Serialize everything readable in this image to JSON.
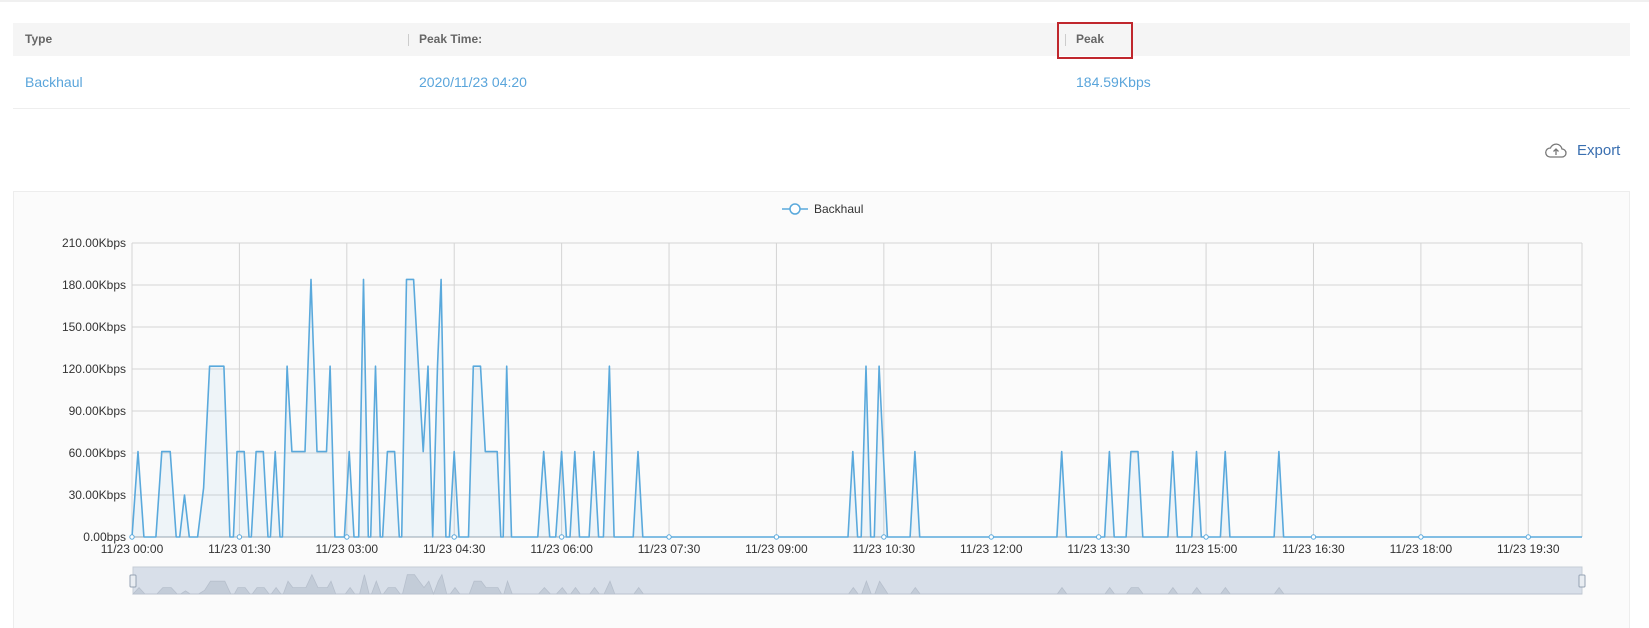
{
  "table": {
    "headers": {
      "type": "Type",
      "peak_time": "Peak Time:",
      "peak": "Peak"
    },
    "row": {
      "type": "Backhaul",
      "peak_time": "2020/11/23 04:20",
      "peak": "184.59Kbps"
    }
  },
  "export": {
    "label": "Export",
    "icon": "cloud-export-icon"
  },
  "colors": {
    "series": "#5aa9dc",
    "link": "#5aa5db",
    "highlight": "#c0272d",
    "slider": "#d8dfe9"
  },
  "chart_data": {
    "type": "line",
    "legend": "Backhaul",
    "legend_position": "top-center",
    "grid": true,
    "y_ticks": [
      "0.00bps",
      "30.00Kbps",
      "60.00Kbps",
      "90.00Kbps",
      "120.00Kbps",
      "150.00Kbps",
      "180.00Kbps",
      "210.00Kbps"
    ],
    "x_ticks": [
      "11/23 00:00",
      "11/23 01:30",
      "11/23 03:00",
      "11/23 04:30",
      "11/23 06:00",
      "11/23 07:30",
      "11/23 09:00",
      "11/23 10:30",
      "11/23 12:00",
      "11/23 13:30",
      "11/23 15:00",
      "11/23 16:30",
      "11/23 18:00",
      "11/23 19:30"
    ],
    "ylim_kbps": [
      0,
      210
    ],
    "x_minutes": [
      1200,
      1215
    ],
    "series": [
      {
        "name": "Backhaul",
        "points_minutes_kbps": [
          [
            0,
            0
          ],
          [
            5,
            61
          ],
          [
            10,
            0
          ],
          [
            20,
            0
          ],
          [
            25,
            61
          ],
          [
            32,
            61
          ],
          [
            37,
            0
          ],
          [
            40,
            0
          ],
          [
            44,
            30
          ],
          [
            48,
            0
          ],
          [
            55,
            0
          ],
          [
            60,
            35
          ],
          [
            65,
            122
          ],
          [
            72,
            122
          ],
          [
            77,
            122
          ],
          [
            82,
            0
          ],
          [
            85,
            0
          ],
          [
            88,
            61
          ],
          [
            94,
            61
          ],
          [
            98,
            0
          ],
          [
            100,
            0
          ],
          [
            104,
            61
          ],
          [
            110,
            61
          ],
          [
            114,
            0
          ],
          [
            116,
            0
          ],
          [
            120,
            61
          ],
          [
            124,
            0
          ],
          [
            126,
            0
          ],
          [
            130,
            122
          ],
          [
            134,
            61
          ],
          [
            145,
            61
          ],
          [
            150,
            184
          ],
          [
            155,
            61
          ],
          [
            163,
            61
          ],
          [
            166,
            122
          ],
          [
            170,
            0
          ],
          [
            178,
            0
          ],
          [
            182,
            61
          ],
          [
            186,
            0
          ],
          [
            190,
            0
          ],
          [
            194,
            184
          ],
          [
            198,
            0
          ],
          [
            200,
            0
          ],
          [
            204,
            122
          ],
          [
            208,
            0
          ],
          [
            210,
            0
          ],
          [
            214,
            61
          ],
          [
            220,
            61
          ],
          [
            224,
            0
          ],
          [
            226,
            0
          ],
          [
            230,
            184
          ],
          [
            236,
            184
          ],
          [
            240,
            122
          ],
          [
            244,
            61
          ],
          [
            248,
            122
          ],
          [
            252,
            0
          ],
          [
            256,
            122
          ],
          [
            259,
            184
          ],
          [
            263,
            0
          ],
          [
            266,
            0
          ],
          [
            270,
            61
          ],
          [
            274,
            0
          ],
          [
            282,
            0
          ],
          [
            286,
            122
          ],
          [
            292,
            122
          ],
          [
            296,
            61
          ],
          [
            306,
            61
          ],
          [
            309,
            0
          ],
          [
            311,
            0
          ],
          [
            314,
            122
          ],
          [
            318,
            0
          ],
          [
            340,
            0
          ],
          [
            345,
            61
          ],
          [
            350,
            0
          ],
          [
            355,
            0
          ],
          [
            360,
            61
          ],
          [
            364,
            0
          ],
          [
            367,
            0
          ],
          [
            371,
            61
          ],
          [
            375,
            0
          ],
          [
            383,
            0
          ],
          [
            387,
            61
          ],
          [
            391,
            0
          ],
          [
            395,
            0
          ],
          [
            400,
            122
          ],
          [
            404,
            0
          ],
          [
            420,
            0
          ],
          [
            424,
            61
          ],
          [
            428,
            0
          ],
          [
            600,
            0
          ],
          [
            604,
            61
          ],
          [
            608,
            0
          ],
          [
            611,
            0
          ],
          [
            615,
            122
          ],
          [
            619,
            0
          ],
          [
            622,
            0
          ],
          [
            626,
            122
          ],
          [
            633,
            0
          ],
          [
            652,
            0
          ],
          [
            656,
            61
          ],
          [
            660,
            0
          ],
          [
            775,
            0
          ],
          [
            779,
            61
          ],
          [
            783,
            0
          ],
          [
            815,
            0
          ],
          [
            819,
            61
          ],
          [
            823,
            0
          ],
          [
            833,
            0
          ],
          [
            837,
            61
          ],
          [
            843,
            61
          ],
          [
            847,
            0
          ],
          [
            868,
            0
          ],
          [
            872,
            61
          ],
          [
            876,
            0
          ],
          [
            888,
            0
          ],
          [
            892,
            61
          ],
          [
            896,
            0
          ],
          [
            912,
            0
          ],
          [
            916,
            61
          ],
          [
            920,
            0
          ],
          [
            957,
            0
          ],
          [
            961,
            61
          ],
          [
            965,
            0
          ],
          [
            1215,
            0
          ]
        ]
      }
    ]
  }
}
